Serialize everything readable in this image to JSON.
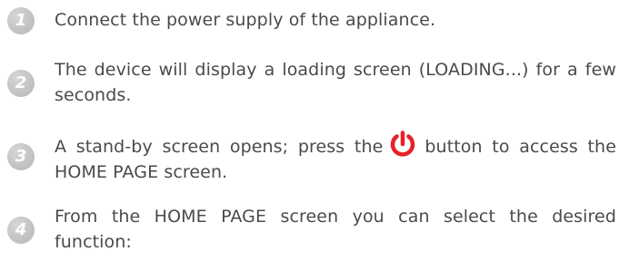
{
  "steps": [
    {
      "number": "1",
      "text": "Connect the power supply of the appliance."
    },
    {
      "number": "2",
      "text": "The device will display a loading screen (LOADING...) for a few seconds."
    },
    {
      "number": "3",
      "text_before": "A stand-by screen opens; press the",
      "icon": "power-icon",
      "text_after": "button to access the HOME PAGE screen."
    },
    {
      "number": "4",
      "text": "From the HOME PAGE screen you can select the desired function:"
    }
  ],
  "colors": {
    "text": "#4a4a4a",
    "badge": "#c4c4c4",
    "power_icon": "#e8202a"
  }
}
